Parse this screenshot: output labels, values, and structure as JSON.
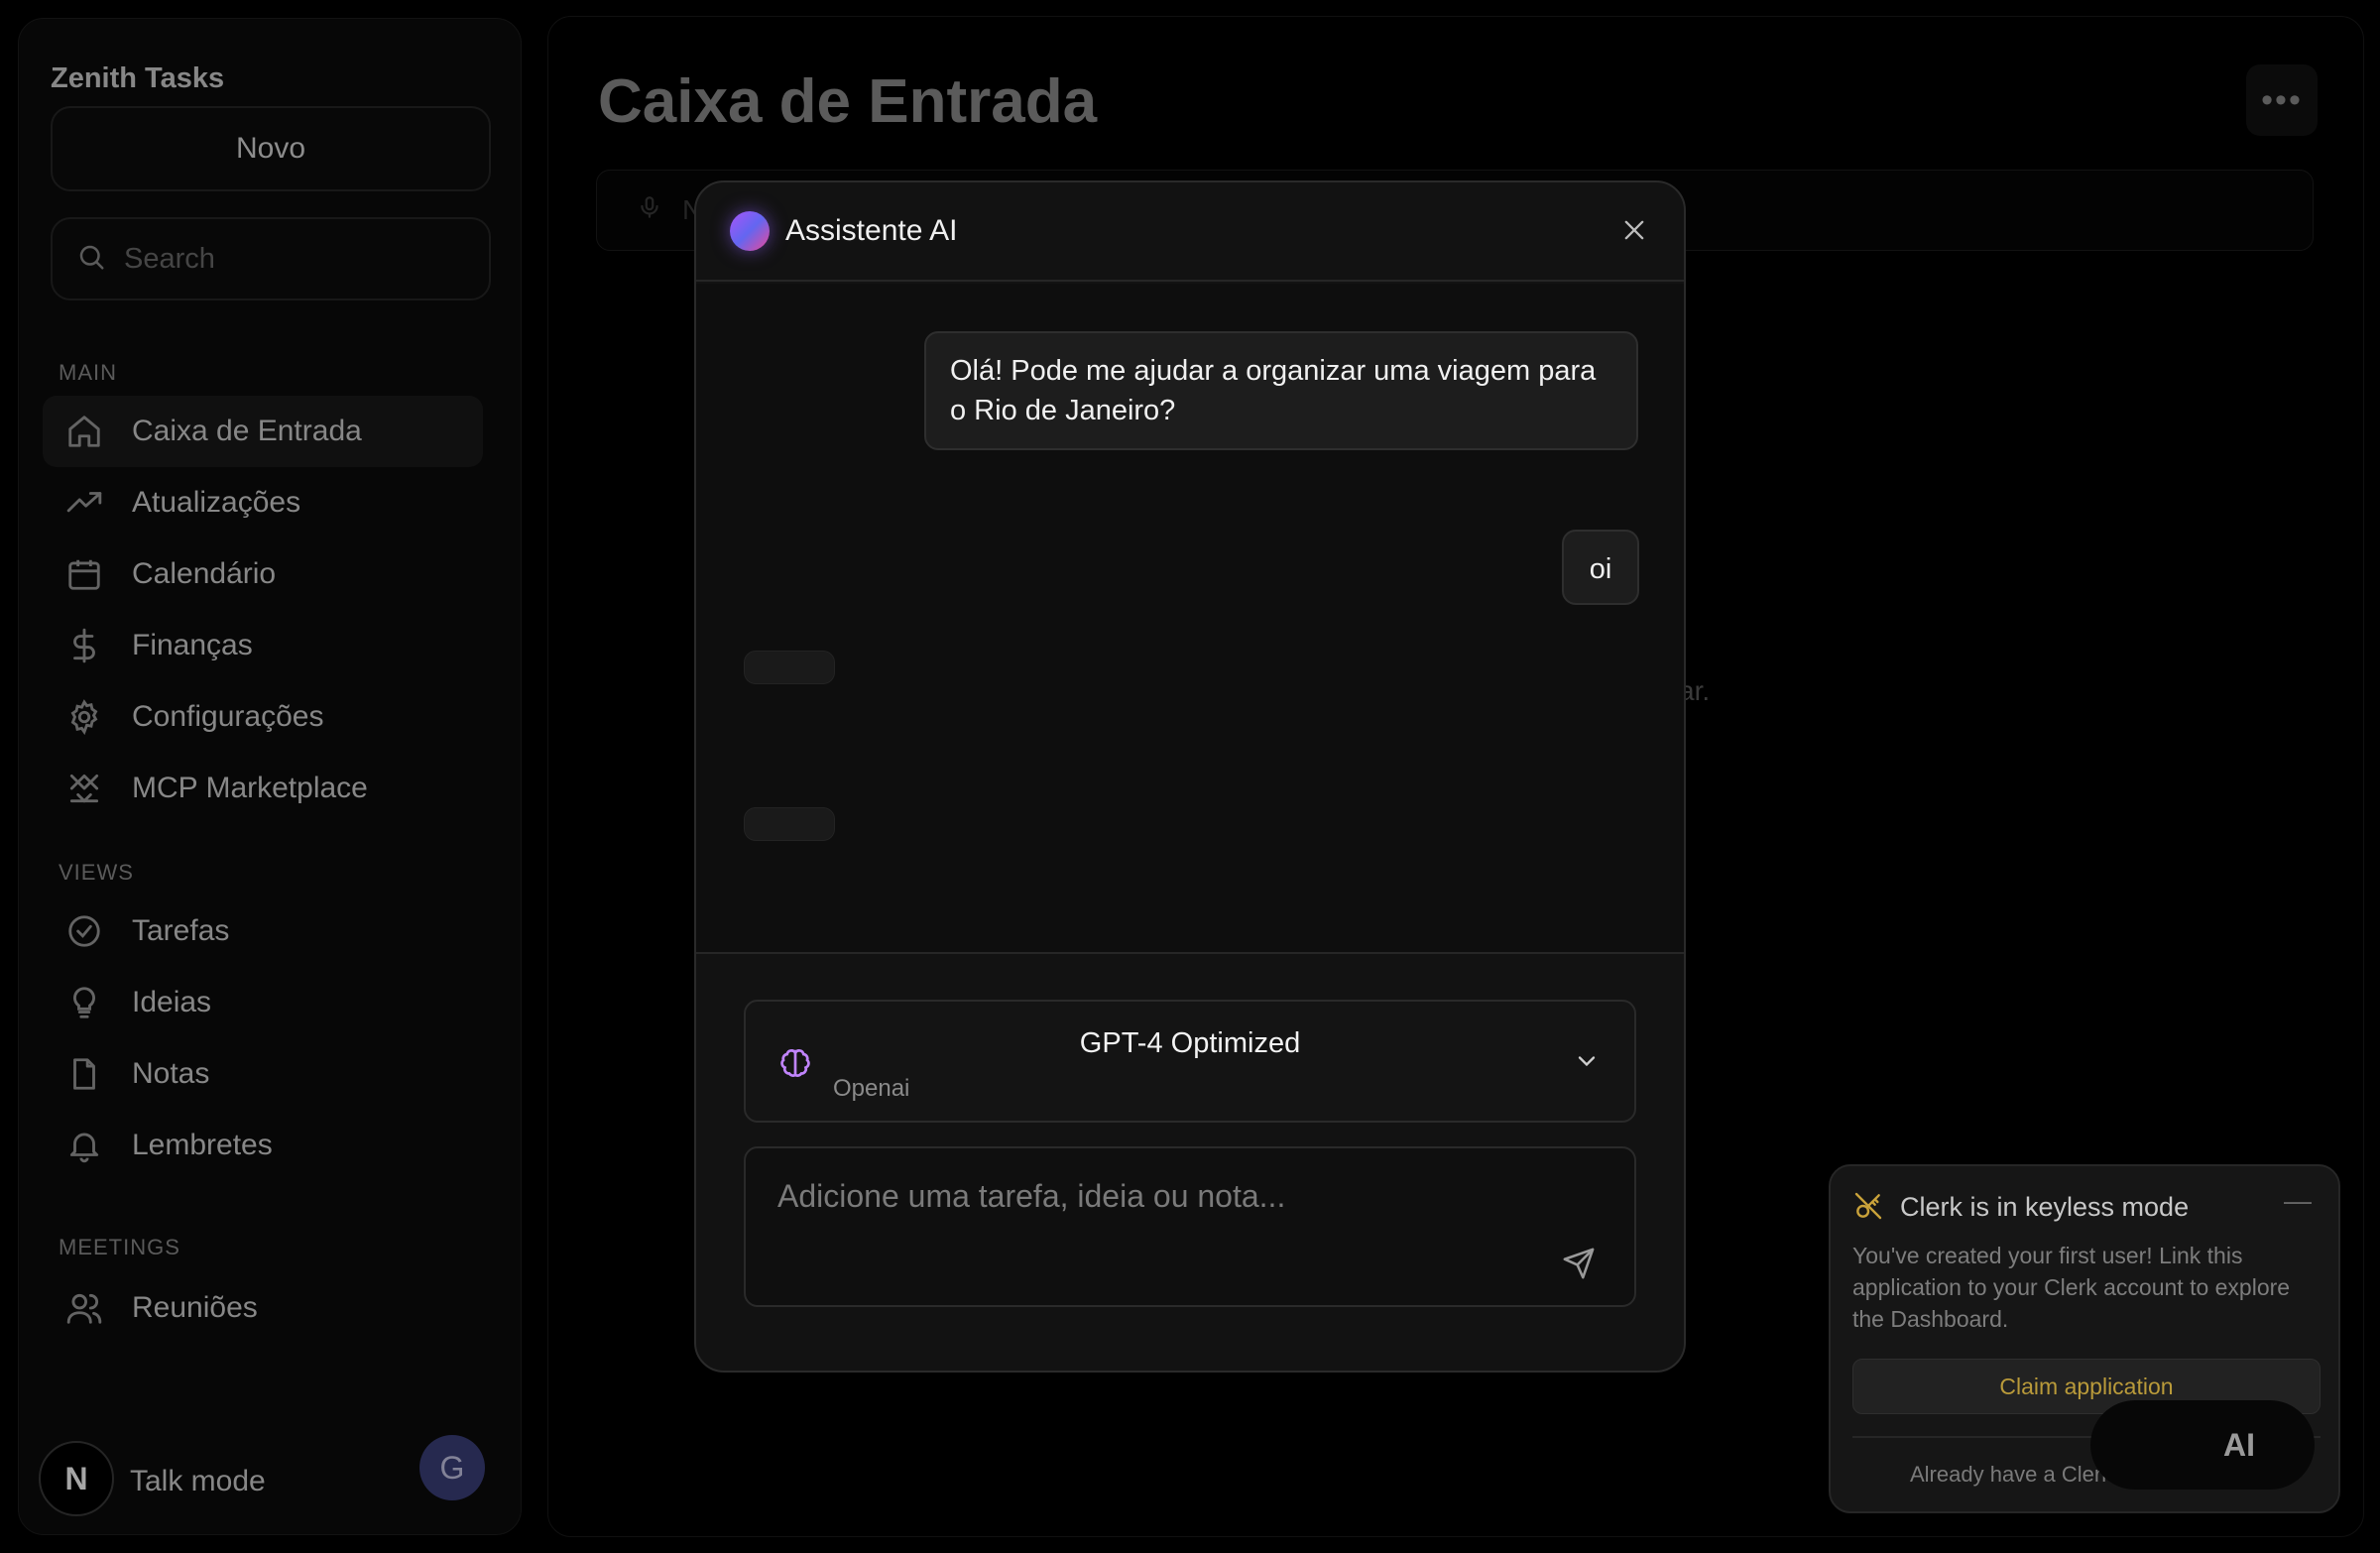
{
  "app": {
    "title": "Zenith Tasks"
  },
  "sidebar": {
    "new_label": "Novo",
    "search_placeholder": "Search",
    "sections": {
      "main": "MAIN",
      "views": "VIEWS",
      "meetings": "MEETINGS"
    },
    "items": [
      {
        "label": "Caixa de Entrada",
        "icon": "home-icon",
        "active": true
      },
      {
        "label": "Atualizações",
        "icon": "trending-up-icon"
      },
      {
        "label": "Calendário",
        "icon": "calendar-icon"
      },
      {
        "label": "Finanças",
        "icon": "dollar-icon"
      },
      {
        "label": "Configurações",
        "icon": "gear-icon"
      },
      {
        "label": "MCP Marketplace",
        "icon": "mcp-icon"
      },
      {
        "label": "Tarefas",
        "icon": "check-circle-icon"
      },
      {
        "label": "Ideias",
        "icon": "lightbulb-icon"
      },
      {
        "label": "Notas",
        "icon": "file-icon"
      },
      {
        "label": "Lembretes",
        "icon": "bell-icon"
      },
      {
        "label": "Reuniões",
        "icon": "users-icon"
      }
    ],
    "talk_mode": "Talk mode",
    "logo_letter": "N",
    "avatar_letter": "G"
  },
  "main": {
    "title": "Caixa de Entrada",
    "input_partial": "N",
    "behind_text": "ar."
  },
  "modal": {
    "title": "Assistente AI",
    "messages": [
      {
        "role": "user",
        "text": "Olá! Pode me ajudar a organizar uma viagem para o Rio de Janeiro?"
      },
      {
        "role": "user",
        "text": "oi"
      }
    ],
    "model": {
      "name": "GPT-4 Optimized",
      "provider": "Openai"
    },
    "compose_placeholder": "Adicione uma tarefa, ideia ou nota..."
  },
  "clerk": {
    "title": "Clerk is in keyless mode",
    "body": "You've created your first user! Link this application to your Clerk account to explore the Dashboard.",
    "claim_label": "Claim application",
    "footer": "Already have a Clerk"
  },
  "ai_fab": {
    "label": "AI"
  },
  "colors": {
    "accent_purple": "#a855f7",
    "clerk_gold": "#b99a3a",
    "avatar_bg": "#3b3f7a"
  }
}
